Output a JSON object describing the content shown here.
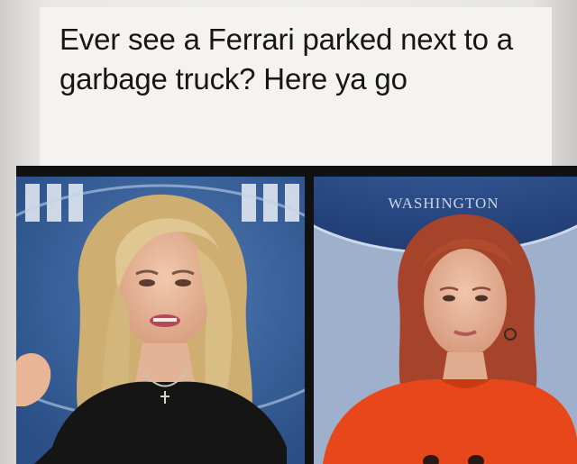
{
  "post": {
    "caption": "Ever see a Ferrari parked next to a garbage truck? Here ya go"
  },
  "photos": {
    "left": {
      "description_icon": "photo-person-blonde"
    },
    "right": {
      "sign_text": "WASHINGTON",
      "description_icon": "photo-person-redhead"
    }
  },
  "colors": {
    "backdrop_blue": "#2f5b9a",
    "shirt_orange": "#e8471c",
    "hair_blonde": "#d9c08a",
    "hair_red": "#a8432a"
  }
}
